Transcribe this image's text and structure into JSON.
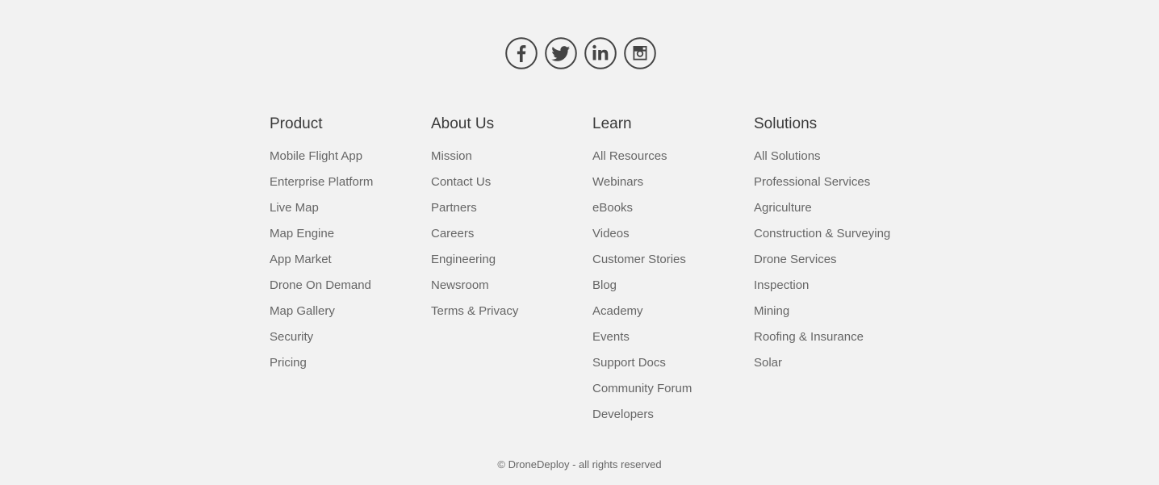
{
  "social": {
    "icons": [
      "facebook-icon",
      "twitter-icon",
      "linkedin-icon",
      "instagram-icon"
    ],
    "icon_color": "#444444"
  },
  "columns": [
    {
      "title": "Product",
      "links": [
        "Mobile Flight App",
        "Enterprise Platform",
        "Live Map",
        "Map Engine",
        "App Market",
        "Drone On Demand",
        "Map Gallery",
        "Security",
        "Pricing"
      ]
    },
    {
      "title": "About Us",
      "links": [
        "Mission",
        "Contact Us",
        "Partners",
        "Careers",
        "Engineering",
        "Newsroom",
        "Terms & Privacy"
      ]
    },
    {
      "title": "Learn",
      "links": [
        "All Resources",
        "Webinars",
        "eBooks",
        "Videos",
        "Customer Stories",
        "Blog",
        "Academy",
        "Events",
        "Support Docs",
        "Community Forum",
        "Developers"
      ]
    },
    {
      "title": "Solutions",
      "links": [
        "All Solutions",
        "Professional Services",
        "Agriculture",
        "Construction & Surveying",
        "Drone Services",
        "Inspection",
        "Mining",
        "Roofing & Insurance",
        "Solar"
      ]
    }
  ],
  "copyright": "© DroneDeploy - all rights reserved",
  "colors": {
    "background": "#f2f2f2",
    "heading": "#3a3a3a",
    "link": "#666666"
  }
}
